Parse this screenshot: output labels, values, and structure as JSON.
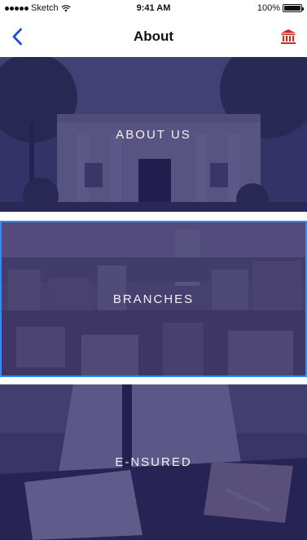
{
  "status_bar": {
    "carrier": "Sketch",
    "time": "9:41 AM",
    "battery": "100%",
    "battery_level": 1.0
  },
  "nav": {
    "title": "About",
    "back_icon": "chevron-left-icon",
    "right_icon": "bank-icon",
    "accent_color": "#1f4fd8",
    "right_icon_color": "#d9261c"
  },
  "cards": [
    {
      "label": "ABOUT US",
      "theme": "building-facade",
      "selected": false
    },
    {
      "label": "BRANCHES",
      "theme": "city-skyline",
      "selected": true
    },
    {
      "label": "E-NSURED",
      "theme": "desk-documents",
      "selected": false
    }
  ],
  "colors": {
    "overlay": "#262164",
    "selection_border": "#2f8cff",
    "card_text": "#f1f1f7"
  }
}
